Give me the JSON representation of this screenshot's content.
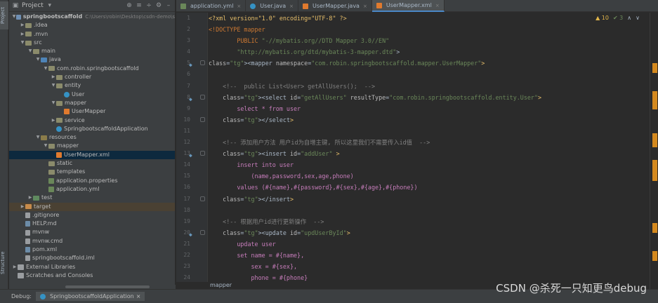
{
  "left_strip": {
    "project_tab": "Project",
    "structure_tab": "Structure",
    "bookmarks_tab": "arks"
  },
  "project_panel": {
    "title": "Project",
    "tree": [
      {
        "depth": 0,
        "arrow": "down",
        "icon": "module",
        "label": "springbootscaffold",
        "extra": "C:\\Users\\robin\\Desktop\\csdn-demo\\s",
        "bold": true
      },
      {
        "depth": 1,
        "arrow": "right",
        "icon": "folder",
        "label": ".idea"
      },
      {
        "depth": 1,
        "arrow": "right",
        "icon": "folder",
        "label": ".mvn"
      },
      {
        "depth": 1,
        "arrow": "down",
        "icon": "folder",
        "label": "src"
      },
      {
        "depth": 2,
        "arrow": "down",
        "icon": "folder",
        "label": "main"
      },
      {
        "depth": 3,
        "arrow": "down",
        "icon": "folder-src",
        "label": "java"
      },
      {
        "depth": 4,
        "arrow": "down",
        "icon": "folder",
        "label": "com.robin.springbootscaffold"
      },
      {
        "depth": 5,
        "arrow": "right",
        "icon": "folder",
        "label": "controller"
      },
      {
        "depth": 5,
        "arrow": "down",
        "icon": "folder",
        "label": "entity"
      },
      {
        "depth": 6,
        "arrow": "",
        "icon": "class",
        "label": "User"
      },
      {
        "depth": 5,
        "arrow": "down",
        "icon": "folder",
        "label": "mapper"
      },
      {
        "depth": 6,
        "arrow": "",
        "icon": "xml",
        "label": "UserMapper"
      },
      {
        "depth": 5,
        "arrow": "right",
        "icon": "folder",
        "label": "service"
      },
      {
        "depth": 5,
        "arrow": "",
        "icon": "class",
        "label": "SpringbootscaffoldApplication"
      },
      {
        "depth": 3,
        "arrow": "down",
        "icon": "folder-res",
        "label": "resources"
      },
      {
        "depth": 4,
        "arrow": "down",
        "icon": "folder",
        "label": "mapper"
      },
      {
        "depth": 5,
        "arrow": "",
        "icon": "xml",
        "label": "UserMapper.xml",
        "selected": true
      },
      {
        "depth": 4,
        "arrow": "",
        "icon": "folder",
        "label": "static"
      },
      {
        "depth": 4,
        "arrow": "",
        "icon": "folder",
        "label": "templates"
      },
      {
        "depth": 4,
        "arrow": "",
        "icon": "props",
        "label": "application.properties"
      },
      {
        "depth": 4,
        "arrow": "",
        "icon": "props",
        "label": "application.yml"
      },
      {
        "depth": 2,
        "arrow": "right",
        "icon": "folder-test",
        "label": "test"
      },
      {
        "depth": 1,
        "arrow": "right",
        "icon": "folder-target",
        "label": "target",
        "target": true
      },
      {
        "depth": 1,
        "arrow": "",
        "icon": "file",
        "label": ".gitignore"
      },
      {
        "depth": 1,
        "arrow": "",
        "icon": "md",
        "label": "HELP.md"
      },
      {
        "depth": 1,
        "arrow": "",
        "icon": "file",
        "label": "mvnw"
      },
      {
        "depth": 1,
        "arrow": "",
        "icon": "file",
        "label": "mvnw.cmd"
      },
      {
        "depth": 1,
        "arrow": "",
        "icon": "md",
        "label": "pom.xml"
      },
      {
        "depth": 1,
        "arrow": "",
        "icon": "file",
        "label": "springbootscaffold.iml"
      },
      {
        "depth": 0,
        "arrow": "right",
        "icon": "libs",
        "label": "External Libraries"
      },
      {
        "depth": 0,
        "arrow": "",
        "icon": "libs",
        "label": "Scratches and Consoles"
      }
    ]
  },
  "tabs": [
    {
      "label": "application.yml",
      "icon": "props",
      "active": false
    },
    {
      "label": "User.java",
      "icon": "class",
      "active": false
    },
    {
      "label": "UserMapper.java",
      "icon": "xml",
      "active": false
    },
    {
      "label": "UserMapper.xml",
      "icon": "xml",
      "active": true
    }
  ],
  "inspection": {
    "warnings": "▲ 10",
    "ok": "✔ 3"
  },
  "line_numbers": [
    "1",
    "2",
    "3",
    "4",
    "5",
    "6",
    "7",
    "8",
    "9",
    "10",
    "11",
    "12",
    "13",
    "14",
    "15",
    "16",
    "17",
    "18",
    "19",
    "20",
    "21",
    "22",
    "23",
    "24"
  ],
  "code_lines": [
    "<?xml version=\"1.0\" encoding=\"UTF-8\" ?>",
    "<!DOCTYPE mapper",
    "        PUBLIC \"-//mybatis.org//DTD Mapper 3.0//EN\"",
    "        \"http://mybatis.org/dtd/mybatis-3-mapper.dtd\">",
    "<mapper namespace=\"com.robin.springbootscaffold.mapper.UserMapper\">",
    "",
    "    <!--  public List<User> getAllUsers();  -->",
    "    <select id=\"getAllUsers\" resultType=\"com.robin.springbootscaffold.entity.User\">",
    "        select * from user",
    "    </select>",
    "",
    "    <!-- 添加用户方法 用户id为自增主键, 所以这里我们不需要传入id值  -->",
    "    <insert id=\"addUser\" >",
    "        insert into user",
    "            (name,password,sex,age,phone)",
    "        values (#{name},#{password},#{sex},#{age},#{phone})",
    "    </insert>",
    "",
    "    <!-- 根据用户id进行更新操作  -->",
    "    <update id=\"updUserById\">",
    "        update user",
    "        set name = #{name},",
    "            sex = #{sex},",
    "            phone = #{phone}"
  ],
  "breadcrumb": "mapper",
  "debug": {
    "label": "Debug:",
    "config": "SpringbootscaffoldApplication"
  },
  "watermark": "CSDN @杀死一只知更鸟debug"
}
